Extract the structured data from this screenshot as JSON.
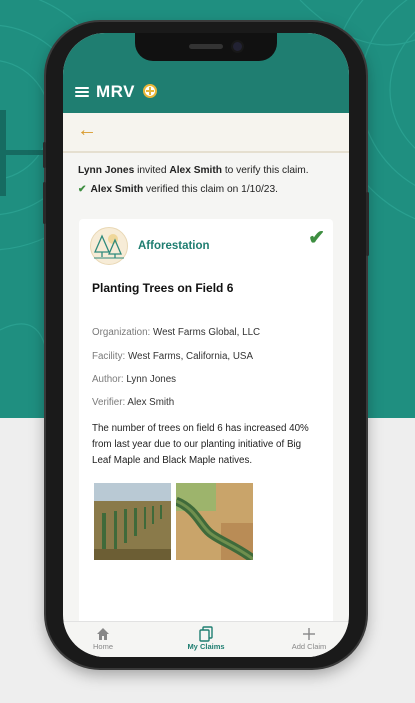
{
  "app": {
    "brand": "MRV"
  },
  "nav": {
    "back_label": "←"
  },
  "claim": {
    "invite_from": "Lynn Jones",
    "invite_text": " invited ",
    "invite_to": "Alex Smith",
    "invite_suffix": " to verify this claim.",
    "verified_by": "Alex Smith",
    "verified_text": " verified this claim on 1/10/23.",
    "category": "Afforestation",
    "title": "Planting Trees on Field 6",
    "organization_label": "Organization:",
    "organization": "West Farms Global, LLC",
    "facility_label": "Facility:",
    "facility": "West Farms, California, USA",
    "author_label": "Author:",
    "author": "Lynn Jones",
    "verifier_label": "Verifier:",
    "verifier": "Alex Smith",
    "description": "The number of trees on field 6 has increased 40% from last year due to our planting initiative of Big Leaf Maple and Black Maple natives.",
    "status_icon": "check-icon"
  },
  "bottom_nav": [
    {
      "label": "Home",
      "icon": "home-icon"
    },
    {
      "label": "My Claims",
      "icon": "claims-icon",
      "active": true
    },
    {
      "label": "Add Claim",
      "icon": "plus-icon"
    }
  ],
  "colors": {
    "primary": "#1f7e71",
    "accent": "#d99a2b",
    "success": "#3e8e41"
  }
}
